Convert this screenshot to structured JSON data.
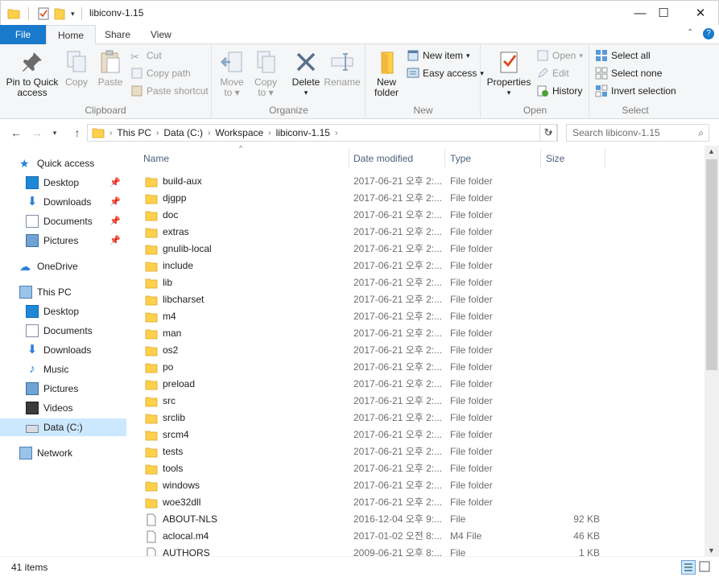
{
  "window": {
    "title": "libiconv-1.15",
    "controls": {
      "minimize": "—",
      "maximize": "☐",
      "close": "✕"
    }
  },
  "ribbon_tabs": [
    {
      "label": "File"
    },
    {
      "label": "Home"
    },
    {
      "label": "Share"
    },
    {
      "label": "View"
    }
  ],
  "ribbon": {
    "clipboard": {
      "label": "Clipboard",
      "pin_label_1": "Pin to Quick",
      "pin_label_2": "access",
      "copy": "Copy",
      "paste": "Paste",
      "cut": "Cut",
      "copy_path": "Copy path",
      "paste_shortcut": "Paste shortcut"
    },
    "organize": {
      "label": "Organize",
      "move_to_1": "Move",
      "move_to_2": "to",
      "copy_to_1": "Copy",
      "copy_to_2": "to",
      "delete": "Delete",
      "rename": "Rename"
    },
    "new": {
      "label": "New",
      "new_folder_1": "New",
      "new_folder_2": "folder",
      "new_item": "New item",
      "easy_access": "Easy access"
    },
    "open": {
      "label": "Open",
      "properties": "Properties",
      "open": "Open",
      "edit": "Edit",
      "history": "History"
    },
    "select": {
      "label": "Select",
      "select_all": "Select all",
      "select_none": "Select none",
      "invert_selection": "Invert selection"
    }
  },
  "address": {
    "crumbs": [
      "This PC",
      "Data (C:)",
      "Workspace",
      "libiconv-1.15"
    ],
    "search_placeholder": "Search libiconv-1.15"
  },
  "nav": {
    "quick_access": "Quick access",
    "quick_items": [
      "Desktop",
      "Downloads",
      "Documents",
      "Pictures"
    ],
    "onedrive": "OneDrive",
    "this_pc": "This PC",
    "pc_items": [
      "Desktop",
      "Documents",
      "Downloads",
      "Music",
      "Pictures",
      "Videos",
      "Data (C:)"
    ],
    "network": "Network"
  },
  "columns": {
    "name": "Name",
    "date": "Date modified",
    "type": "Type",
    "size": "Size"
  },
  "files": [
    {
      "name": "build-aux",
      "date": "2017-06-21 오후 2:...",
      "type": "File folder",
      "size": "",
      "kind": "folder"
    },
    {
      "name": "djgpp",
      "date": "2017-06-21 오후 2:...",
      "type": "File folder",
      "size": "",
      "kind": "folder"
    },
    {
      "name": "doc",
      "date": "2017-06-21 오후 2:...",
      "type": "File folder",
      "size": "",
      "kind": "folder"
    },
    {
      "name": "extras",
      "date": "2017-06-21 오후 2:...",
      "type": "File folder",
      "size": "",
      "kind": "folder"
    },
    {
      "name": "gnulib-local",
      "date": "2017-06-21 오후 2:...",
      "type": "File folder",
      "size": "",
      "kind": "folder"
    },
    {
      "name": "include",
      "date": "2017-06-21 오후 2:...",
      "type": "File folder",
      "size": "",
      "kind": "folder"
    },
    {
      "name": "lib",
      "date": "2017-06-21 오후 2:...",
      "type": "File folder",
      "size": "",
      "kind": "folder"
    },
    {
      "name": "libcharset",
      "date": "2017-06-21 오후 2:...",
      "type": "File folder",
      "size": "",
      "kind": "folder"
    },
    {
      "name": "m4",
      "date": "2017-06-21 오후 2:...",
      "type": "File folder",
      "size": "",
      "kind": "folder"
    },
    {
      "name": "man",
      "date": "2017-06-21 오후 2:...",
      "type": "File folder",
      "size": "",
      "kind": "folder"
    },
    {
      "name": "os2",
      "date": "2017-06-21 오후 2:...",
      "type": "File folder",
      "size": "",
      "kind": "folder"
    },
    {
      "name": "po",
      "date": "2017-06-21 오후 2:...",
      "type": "File folder",
      "size": "",
      "kind": "folder"
    },
    {
      "name": "preload",
      "date": "2017-06-21 오후 2:...",
      "type": "File folder",
      "size": "",
      "kind": "folder"
    },
    {
      "name": "src",
      "date": "2017-06-21 오후 2:...",
      "type": "File folder",
      "size": "",
      "kind": "folder"
    },
    {
      "name": "srclib",
      "date": "2017-06-21 오후 2:...",
      "type": "File folder",
      "size": "",
      "kind": "folder"
    },
    {
      "name": "srcm4",
      "date": "2017-06-21 오후 2:...",
      "type": "File folder",
      "size": "",
      "kind": "folder"
    },
    {
      "name": "tests",
      "date": "2017-06-21 오후 2:...",
      "type": "File folder",
      "size": "",
      "kind": "folder"
    },
    {
      "name": "tools",
      "date": "2017-06-21 오후 2:...",
      "type": "File folder",
      "size": "",
      "kind": "folder"
    },
    {
      "name": "windows",
      "date": "2017-06-21 오후 2:...",
      "type": "File folder",
      "size": "",
      "kind": "folder"
    },
    {
      "name": "woe32dll",
      "date": "2017-06-21 오후 2:...",
      "type": "File folder",
      "size": "",
      "kind": "folder"
    },
    {
      "name": "ABOUT-NLS",
      "date": "2016-12-04 오후 9:...",
      "type": "File",
      "size": "92 KB",
      "kind": "file"
    },
    {
      "name": "aclocal.m4",
      "date": "2017-01-02 오전 8:...",
      "type": "M4 File",
      "size": "46 KB",
      "kind": "file"
    },
    {
      "name": "AUTHORS",
      "date": "2009-06-21 오후 8:...",
      "type": "File",
      "size": "1 KB",
      "kind": "file"
    }
  ],
  "status": {
    "count": "41 items"
  },
  "colors": {
    "accent": "#1979ca",
    "folder": "#ffd04c",
    "selected": "#cce8ff"
  }
}
